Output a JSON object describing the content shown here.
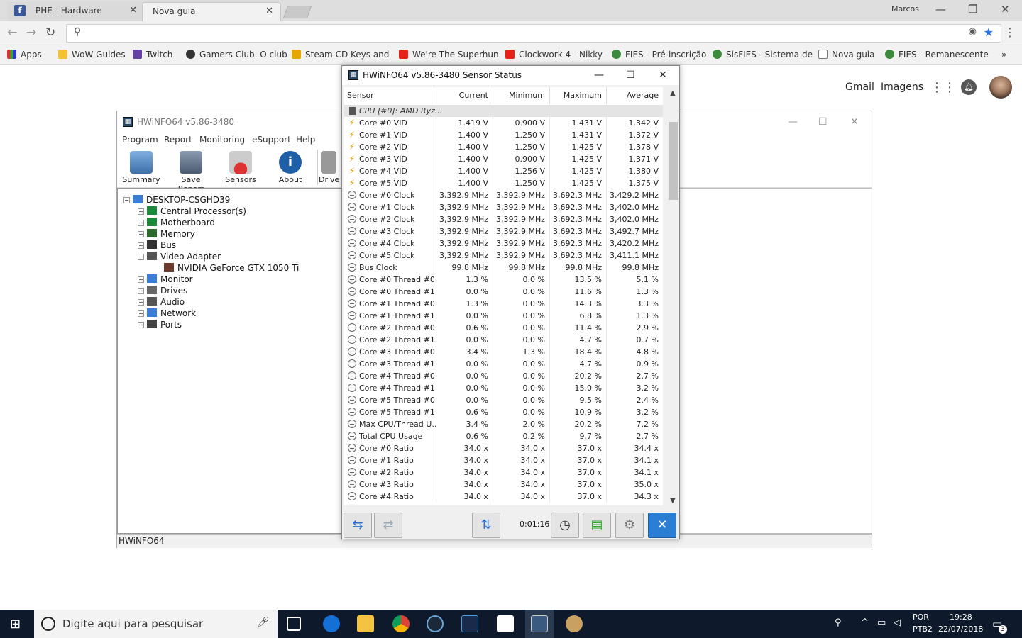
{
  "browser": {
    "tabs": [
      {
        "label": "PHE - Hardware"
      },
      {
        "label": "Nova guia"
      }
    ],
    "user": "Marcos",
    "bookmarks": [
      {
        "label": "Apps",
        "color": "#cc3333"
      },
      {
        "label": "WoW Guides",
        "color": "#f1c232"
      },
      {
        "label": "Twitch",
        "color": "#6441a5"
      },
      {
        "label": "Gamers Club. O club",
        "color": "#333333"
      },
      {
        "label": "Steam CD Keys and",
        "color": "#e6a700"
      },
      {
        "label": "We're The Superhun",
        "color": "#e62117"
      },
      {
        "label": "Clockwork 4 - Nikky",
        "color": "#e62117"
      },
      {
        "label": "FIES - Pré-inscrição",
        "color": "#3c8a3c"
      },
      {
        "label": "SisFIES - Sistema de",
        "color": "#3c8a3c"
      },
      {
        "label": "Nova guia",
        "color": "#ffffff"
      },
      {
        "label": "FIES - Remanescente",
        "color": "#3c8a3c"
      }
    ],
    "overflow": "»"
  },
  "google": {
    "gmail": "Gmail",
    "images": "Imagens"
  },
  "hwinfo": {
    "title": "HWiNFO64 v5.86-3480",
    "menu": [
      "Program",
      "Report",
      "Monitoring",
      "eSupport",
      "Help"
    ],
    "tools": [
      {
        "label": "Summary",
        "color": "#5b8fc7"
      },
      {
        "label": "Save Report",
        "color": "#5a6f8a"
      },
      {
        "label": "Sensors",
        "color": "#c0392b"
      },
      {
        "label": "About",
        "color": "#1f5fa8"
      },
      {
        "label": "Drive",
        "color": "#7a7a7a"
      }
    ],
    "tree": [
      {
        "label": "DESKTOP-CSGHD39",
        "level": 0,
        "exp": "−"
      },
      {
        "label": "Central Processor(s)",
        "level": 1,
        "exp": "+"
      },
      {
        "label": "Motherboard",
        "level": 1,
        "exp": "+"
      },
      {
        "label": "Memory",
        "level": 1,
        "exp": "+"
      },
      {
        "label": "Bus",
        "level": 1,
        "exp": "+"
      },
      {
        "label": "Video Adapter",
        "level": 1,
        "exp": "−"
      },
      {
        "label": "NVIDIA GeForce GTX 1050 Ti",
        "level": 2,
        "exp": ""
      },
      {
        "label": "Monitor",
        "level": 1,
        "exp": "+"
      },
      {
        "label": "Drives",
        "level": 1,
        "exp": "+"
      },
      {
        "label": "Audio",
        "level": 1,
        "exp": "+"
      },
      {
        "label": "Network",
        "level": 1,
        "exp": "+"
      },
      {
        "label": "Ports",
        "level": 1,
        "exp": "+"
      }
    ],
    "status": "HWiNFO64"
  },
  "sensor": {
    "title": "HWiNFO64 v5.86-3480 Sensor Status",
    "columns": [
      "Sensor",
      "Current",
      "Minimum",
      "Maximum",
      "Average"
    ],
    "group": "CPU [#0]: AMD Ryz...",
    "rows": [
      {
        "icon": "bolt",
        "name": "Core #0 VID",
        "cur": "1.419 V",
        "min": "0.900 V",
        "max": "1.431 V",
        "avg": "1.342 V"
      },
      {
        "icon": "bolt",
        "name": "Core #1 VID",
        "cur": "1.400 V",
        "min": "1.250 V",
        "max": "1.431 V",
        "avg": "1.372 V"
      },
      {
        "icon": "bolt",
        "name": "Core #2 VID",
        "cur": "1.400 V",
        "min": "1.250 V",
        "max": "1.425 V",
        "avg": "1.378 V"
      },
      {
        "icon": "bolt",
        "name": "Core #3 VID",
        "cur": "1.400 V",
        "min": "0.900 V",
        "max": "1.425 V",
        "avg": "1.371 V"
      },
      {
        "icon": "bolt",
        "name": "Core #4 VID",
        "cur": "1.400 V",
        "min": "1.256 V",
        "max": "1.425 V",
        "avg": "1.380 V"
      },
      {
        "icon": "bolt",
        "name": "Core #5 VID",
        "cur": "1.400 V",
        "min": "1.250 V",
        "max": "1.425 V",
        "avg": "1.375 V"
      },
      {
        "icon": "clock",
        "name": "Core #0 Clock",
        "cur": "3,392.9 MHz",
        "min": "3,392.9 MHz",
        "max": "3,692.3 MHz",
        "avg": "3,429.2 MHz"
      },
      {
        "icon": "clock",
        "name": "Core #1 Clock",
        "cur": "3,392.9 MHz",
        "min": "3,392.9 MHz",
        "max": "3,692.3 MHz",
        "avg": "3,402.0 MHz"
      },
      {
        "icon": "clock",
        "name": "Core #2 Clock",
        "cur": "3,392.9 MHz",
        "min": "3,392.9 MHz",
        "max": "3,692.3 MHz",
        "avg": "3,402.0 MHz"
      },
      {
        "icon": "clock",
        "name": "Core #3 Clock",
        "cur": "3,392.9 MHz",
        "min": "3,392.9 MHz",
        "max": "3,692.3 MHz",
        "avg": "3,492.7 MHz"
      },
      {
        "icon": "clock",
        "name": "Core #4 Clock",
        "cur": "3,392.9 MHz",
        "min": "3,392.9 MHz",
        "max": "3,692.3 MHz",
        "avg": "3,420.2 MHz"
      },
      {
        "icon": "clock",
        "name": "Core #5 Clock",
        "cur": "3,392.9 MHz",
        "min": "3,392.9 MHz",
        "max": "3,692.3 MHz",
        "avg": "3,411.1 MHz"
      },
      {
        "icon": "clock",
        "name": "Bus Clock",
        "cur": "99.8 MHz",
        "min": "99.8 MHz",
        "max": "99.8 MHz",
        "avg": "99.8 MHz"
      },
      {
        "icon": "clock",
        "name": "Core #0 Thread #0...",
        "cur": "1.3 %",
        "min": "0.0 %",
        "max": "13.5 %",
        "avg": "5.1 %"
      },
      {
        "icon": "clock",
        "name": "Core #0 Thread #1...",
        "cur": "0.0 %",
        "min": "0.0 %",
        "max": "11.6 %",
        "avg": "1.3 %"
      },
      {
        "icon": "clock",
        "name": "Core #1 Thread #0...",
        "cur": "1.3 %",
        "min": "0.0 %",
        "max": "14.3 %",
        "avg": "3.3 %"
      },
      {
        "icon": "clock",
        "name": "Core #1 Thread #1...",
        "cur": "0.0 %",
        "min": "0.0 %",
        "max": "6.8 %",
        "avg": "1.3 %"
      },
      {
        "icon": "clock",
        "name": "Core #2 Thread #0...",
        "cur": "0.6 %",
        "min": "0.0 %",
        "max": "11.4 %",
        "avg": "2.9 %"
      },
      {
        "icon": "clock",
        "name": "Core #2 Thread #1...",
        "cur": "0.0 %",
        "min": "0.0 %",
        "max": "4.7 %",
        "avg": "0.7 %"
      },
      {
        "icon": "clock",
        "name": "Core #3 Thread #0...",
        "cur": "3.4 %",
        "min": "1.3 %",
        "max": "18.4 %",
        "avg": "4.8 %"
      },
      {
        "icon": "clock",
        "name": "Core #3 Thread #1...",
        "cur": "0.0 %",
        "min": "0.0 %",
        "max": "4.7 %",
        "avg": "0.9 %"
      },
      {
        "icon": "clock",
        "name": "Core #4 Thread #0...",
        "cur": "0.0 %",
        "min": "0.0 %",
        "max": "20.2 %",
        "avg": "2.7 %"
      },
      {
        "icon": "clock",
        "name": "Core #4 Thread #1...",
        "cur": "0.0 %",
        "min": "0.0 %",
        "max": "15.0 %",
        "avg": "3.2 %"
      },
      {
        "icon": "clock",
        "name": "Core #5 Thread #0...",
        "cur": "0.0 %",
        "min": "0.0 %",
        "max": "9.5 %",
        "avg": "2.4 %"
      },
      {
        "icon": "clock",
        "name": "Core #5 Thread #1...",
        "cur": "0.6 %",
        "min": "0.0 %",
        "max": "10.9 %",
        "avg": "3.2 %"
      },
      {
        "icon": "clock",
        "name": "Max CPU/Thread U...",
        "cur": "3.4 %",
        "min": "2.0 %",
        "max": "20.2 %",
        "avg": "7.2 %"
      },
      {
        "icon": "clock",
        "name": "Total CPU Usage",
        "cur": "0.6 %",
        "min": "0.2 %",
        "max": "9.7 %",
        "avg": "2.7 %"
      },
      {
        "icon": "clock",
        "name": "Core #0 Ratio",
        "cur": "34.0 x",
        "min": "34.0 x",
        "max": "37.0 x",
        "avg": "34.4 x"
      },
      {
        "icon": "clock",
        "name": "Core #1 Ratio",
        "cur": "34.0 x",
        "min": "34.0 x",
        "max": "37.0 x",
        "avg": "34.1 x"
      },
      {
        "icon": "clock",
        "name": "Core #2 Ratio",
        "cur": "34.0 x",
        "min": "34.0 x",
        "max": "37.0 x",
        "avg": "34.1 x"
      },
      {
        "icon": "clock",
        "name": "Core #3 Ratio",
        "cur": "34.0 x",
        "min": "34.0 x",
        "max": "37.0 x",
        "avg": "35.0 x"
      },
      {
        "icon": "clock",
        "name": "Core #4 Ratio",
        "cur": "34.0 x",
        "min": "34.0 x",
        "max": "37.0 x",
        "avg": "34.3 x"
      }
    ],
    "timer": "0:01:16"
  },
  "taskbar": {
    "search_placeholder": "Digite aqui para pesquisar",
    "lang1": "POR",
    "lang2": "PTB2",
    "time": "19:28",
    "date": "22/07/2018",
    "notifications": "3"
  }
}
